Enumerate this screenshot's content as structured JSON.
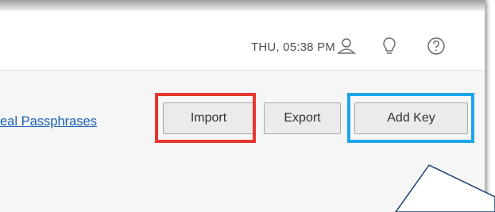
{
  "header": {
    "clock": "THU, 05:38 PM",
    "icons": [
      "user-icon",
      "lightbulb-icon",
      "help-icon"
    ]
  },
  "toolbar": {
    "link_label": "eal Passphrases",
    "import_label": "Import",
    "export_label": "Export",
    "add_key_label": "Add Key"
  },
  "highlights": {
    "import_color": "#e5372f",
    "add_key_color": "#1ca6e8",
    "callout_color": "#1d3f6e"
  }
}
